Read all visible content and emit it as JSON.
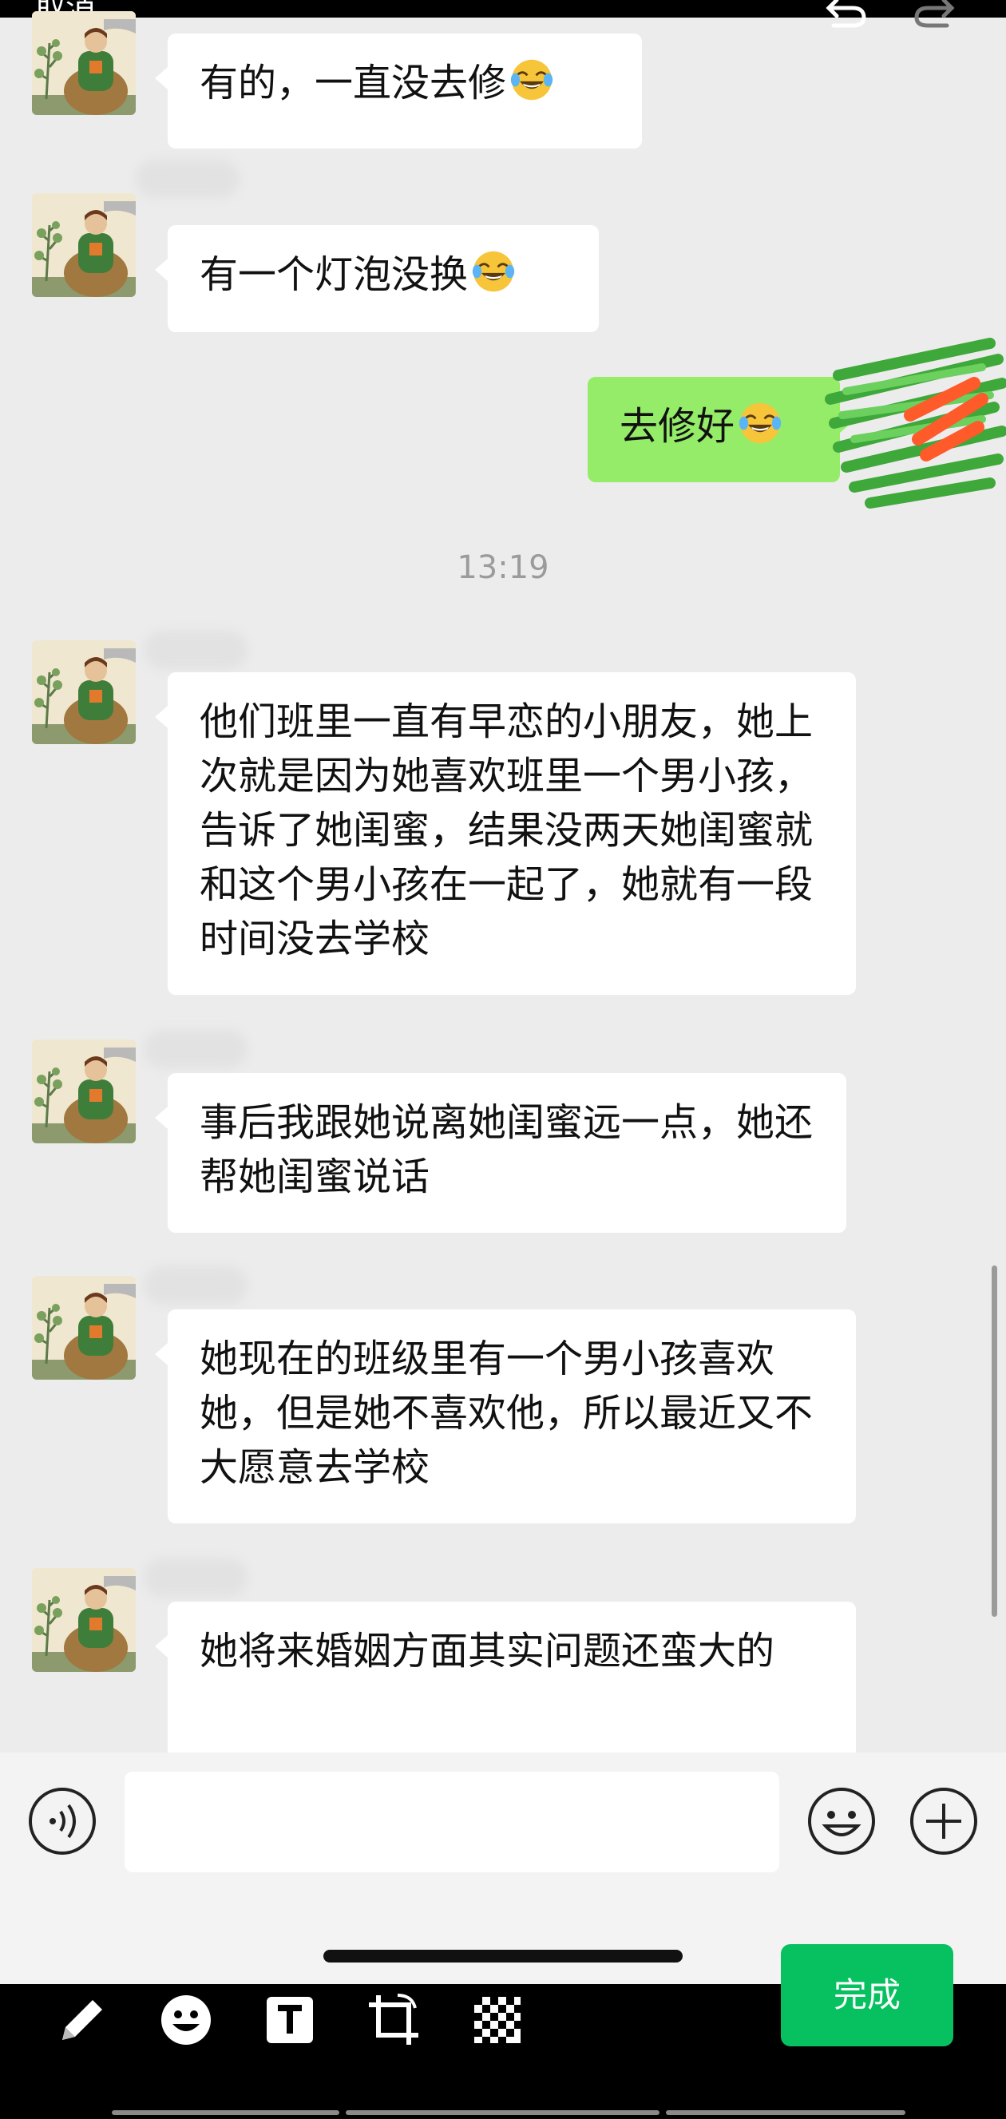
{
  "editor": {
    "cancel_label": "取消",
    "done_label": "完成",
    "undo_icon": "undo-icon",
    "redo_icon": "redo-icon",
    "tools": [
      "pencil-icon",
      "emoji-sticker-icon",
      "text-icon",
      "crop-rotate-icon",
      "mosaic-icon"
    ]
  },
  "chat": {
    "timestamp": "13:19",
    "messages": [
      {
        "side": "left",
        "text": "有的，一直没去修",
        "emoji": "laugh-tears"
      },
      {
        "side": "left",
        "text": "有一个灯泡没换",
        "emoji": "laugh-tears"
      },
      {
        "side": "right",
        "text": "去修好",
        "emoji": "laugh-tears-tilted"
      },
      {
        "side": "left",
        "text": "他们班里一直有早恋的小朋友，她上次就是因为她喜欢班里一个男小孩，告诉了她闺蜜，结果没两天她闺蜜就和这个男小孩在一起了，她就有一段时间没去学校"
      },
      {
        "side": "left",
        "text": "事后我跟她说离她闺蜜远一点，她还帮她闺蜜说话"
      },
      {
        "side": "left",
        "text": "她现在的班级里有一个男小孩喜欢她，但是她不喜欢他，所以最近又不大愿意去学校"
      },
      {
        "side": "left",
        "text": "她将来婚姻方面其实问题还蛮大的"
      }
    ]
  },
  "input_bar": {
    "voice_icon": "voice-icon",
    "emoji_icon": "emoji-icon",
    "plus_icon": "plus-icon",
    "text_value": ""
  },
  "colors": {
    "chat_bg": "#ececec",
    "bubble_left": "#ffffff",
    "bubble_right": "#95ec69",
    "done_button": "#07c160",
    "editor_bar": "#000000"
  }
}
